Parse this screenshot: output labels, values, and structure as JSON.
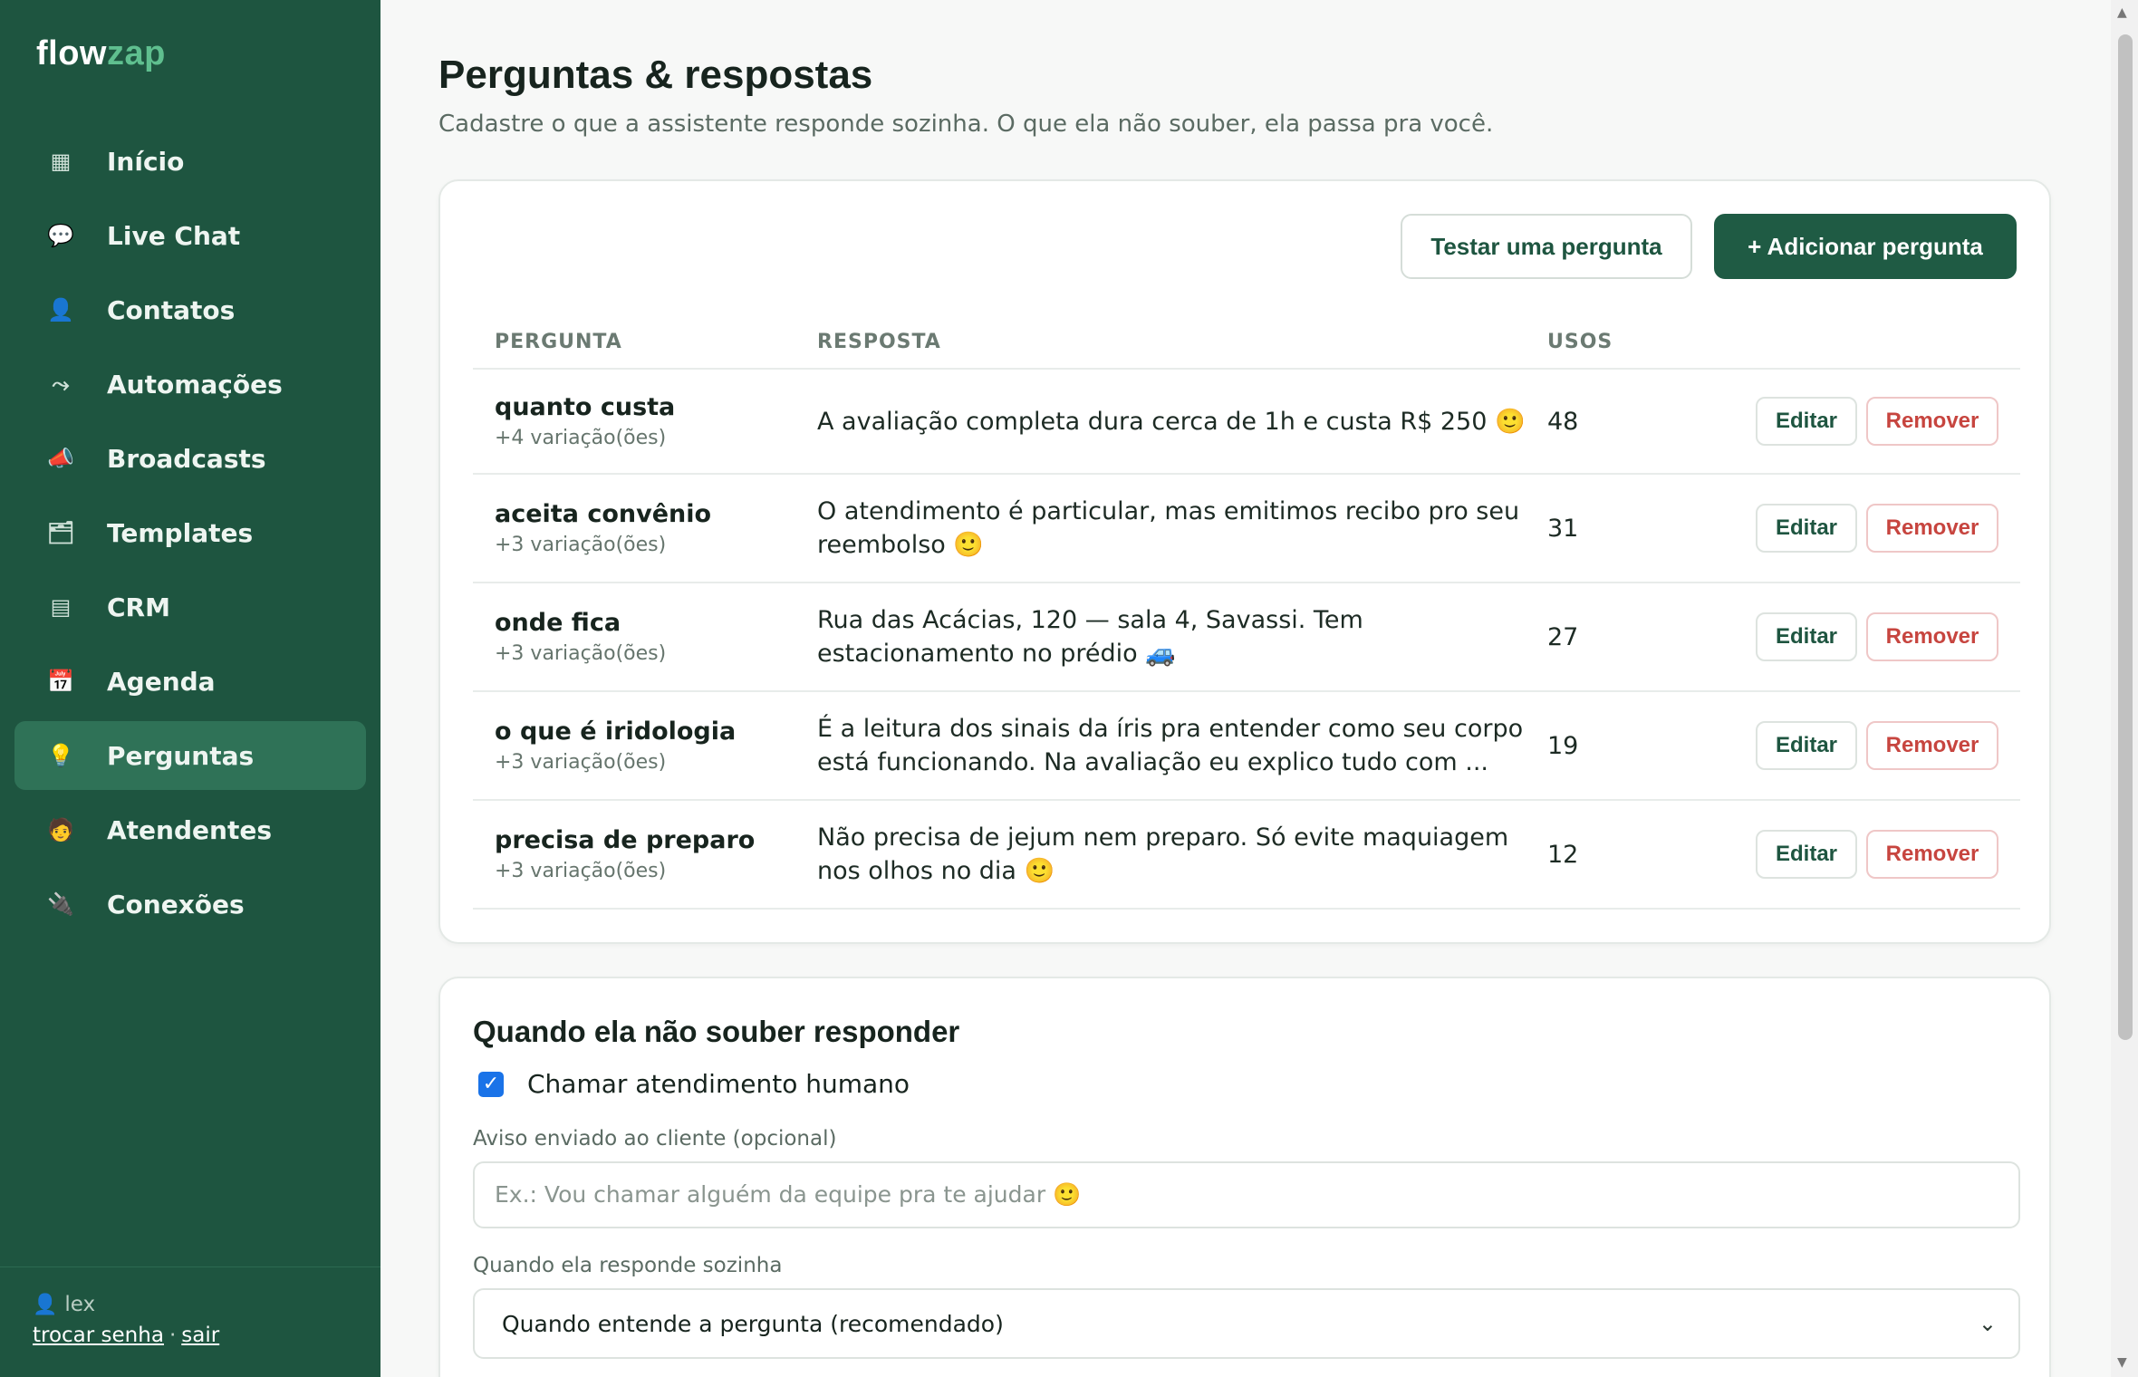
{
  "brand": {
    "part1": "flow",
    "part2": "zap"
  },
  "sidebar": {
    "items": [
      {
        "label": "Início",
        "icon": "▦",
        "icon_name": "grid-icon"
      },
      {
        "label": "Live Chat",
        "icon": "💬",
        "icon_name": "chat-bubble-icon"
      },
      {
        "label": "Contatos",
        "icon": "👤",
        "icon_name": "person-icon"
      },
      {
        "label": "Automações",
        "icon": "⤳",
        "icon_name": "flow-arrow-icon"
      },
      {
        "label": "Broadcasts",
        "icon": "📣",
        "icon_name": "megaphone-icon"
      },
      {
        "label": "Templates",
        "icon": "🗂",
        "icon_name": "folder-icon"
      },
      {
        "label": "CRM",
        "icon": "▤",
        "icon_name": "list-icon"
      },
      {
        "label": "Agenda",
        "icon": "📅",
        "icon_name": "calendar-icon"
      },
      {
        "label": "Perguntas",
        "icon": "💡",
        "icon_name": "lightbulb-icon",
        "active": true
      },
      {
        "label": "Atendentes",
        "icon": "🧑",
        "icon_name": "agent-icon"
      },
      {
        "label": "Conexões",
        "icon": "🔌",
        "icon_name": "plug-icon"
      }
    ],
    "user": {
      "icon": "👤",
      "name": "lex"
    },
    "links": {
      "change_password": "trocar senha",
      "separator": "·",
      "logout": "sair"
    }
  },
  "page": {
    "title": "Perguntas & respostas",
    "subtitle": "Cadastre o que a assistente responde sozinha. O que ela não souber, ela passa pra você."
  },
  "toolbar": {
    "test_label": "Testar uma pergunta",
    "add_label": "+ Adicionar pergunta"
  },
  "table": {
    "headers": {
      "question": "PERGUNTA",
      "answer": "RESPOSTA",
      "uses": "USOS"
    },
    "edit_label": "Editar",
    "remove_label": "Remover",
    "rows": [
      {
        "question": "quanto custa",
        "variations": "+4 variação(ões)",
        "answer": "A avaliação completa dura cerca de 1h e custa R$ 250 🙂",
        "uses": "48"
      },
      {
        "question": "aceita convênio",
        "variations": "+3 variação(ões)",
        "answer": "O atendimento é particular, mas emitimos recibo pro seu reembolso 🙂",
        "uses": "31"
      },
      {
        "question": "onde fica",
        "variations": "+3 variação(ões)",
        "answer": "Rua das Acácias, 120 — sala 4, Savassi. Tem estacionamento no prédio 🚙",
        "uses": "27"
      },
      {
        "question": "o que é iridologia",
        "variations": "+3 variação(ões)",
        "answer": "É a leitura dos sinais da íris pra entender como seu corpo está funcionando. Na avaliação eu explico tudo com ...",
        "uses": "19"
      },
      {
        "question": "precisa de preparo",
        "variations": "+3 variação(ões)",
        "answer": "Não precisa de jejum nem preparo. Só evite maquiagem nos olhos no dia 🙂",
        "uses": "12"
      }
    ]
  },
  "fallback": {
    "title": "Quando ela não souber responder",
    "checkbox_label": "Chamar atendimento humano",
    "checkbox_checked": true,
    "notice_label": "Aviso enviado ao cliente (opcional)",
    "notice_placeholder": "Ex.: Vou chamar alguém da equipe pra te ajudar 🙂",
    "mode_label": "Quando ela responde sozinha",
    "mode_value": "Quando entende a pergunta (recomendado)"
  },
  "colors": {
    "sidebar_bg": "#1e5540",
    "active_item_bg": "#2f7257",
    "primary_button": "#1f5b44",
    "remove_text": "#c7453f",
    "checkbox": "#1a73e8"
  }
}
